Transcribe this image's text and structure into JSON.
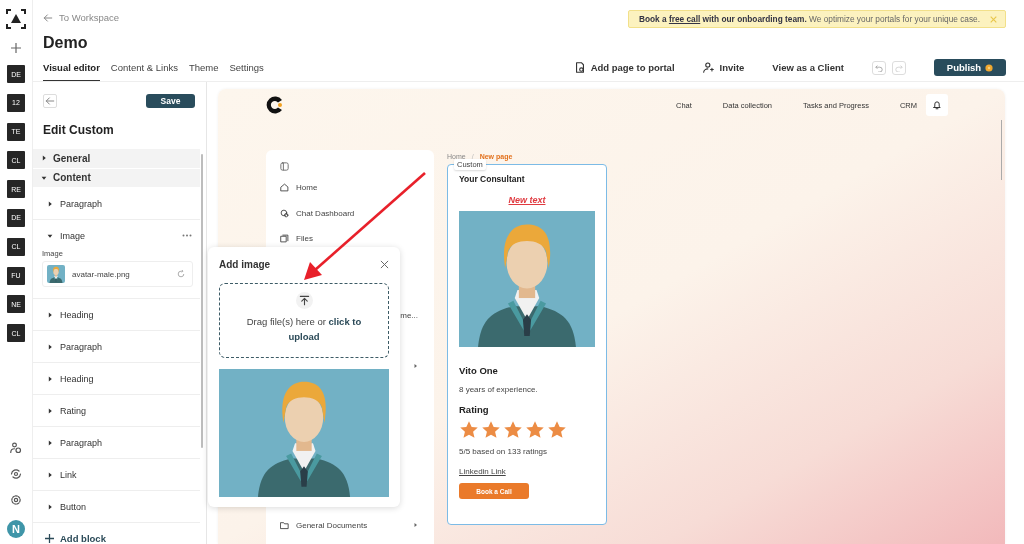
{
  "rail": {
    "tiles": [
      "DE",
      "12",
      "TE",
      "CL",
      "RE",
      "DE",
      "CL",
      "FU",
      "NE",
      "CL"
    ],
    "avatar": "N"
  },
  "header": {
    "back_link": "To Workspace",
    "title": "Demo",
    "tabs": [
      {
        "label": "Visual editor",
        "selected": true
      },
      {
        "label": "Content & Links",
        "selected": false
      },
      {
        "label": "Theme",
        "selected": false
      },
      {
        "label": "Settings",
        "selected": false
      }
    ]
  },
  "banner": {
    "before": "Book a ",
    "link": "free call",
    "after": " with our onboarding team.",
    "message": "We optimize your portals for your unique case."
  },
  "toolbar": {
    "actions": [
      {
        "kind": "add-page",
        "label": "Add page to portal"
      },
      {
        "kind": "invite",
        "label": "Invite"
      },
      {
        "kind": "view",
        "label": "View as a Client"
      }
    ],
    "publish": "Publish"
  },
  "editor_panel": {
    "save": "Save",
    "title": "Edit Custom",
    "sections": [
      {
        "label": "General",
        "expanded": false
      },
      {
        "label": "Content",
        "expanded": true
      }
    ],
    "blocks": [
      {
        "kind": "text",
        "label": "Paragraph",
        "expanded": false
      },
      {
        "kind": "image",
        "label": "Image",
        "expanded": true,
        "field_label": "Image",
        "file_name": "avatar-male.png"
      },
      {
        "kind": "text",
        "label": "Heading",
        "expanded": false
      },
      {
        "kind": "text",
        "label": "Paragraph",
        "expanded": false
      },
      {
        "kind": "text",
        "label": "Heading",
        "expanded": false
      },
      {
        "kind": "text",
        "label": "Rating",
        "expanded": false
      },
      {
        "kind": "text",
        "label": "Paragraph",
        "expanded": false
      },
      {
        "kind": "text",
        "label": "Link",
        "expanded": false
      },
      {
        "kind": "text",
        "label": "Button",
        "expanded": false
      }
    ],
    "add_block": "Add block"
  },
  "portal": {
    "nav": [
      "Chat",
      "Data collection",
      "Tasks and Progress",
      "CRM"
    ],
    "sidebar": [
      {
        "kind": "home",
        "label": "Home"
      },
      {
        "kind": "chat",
        "label": "Chat Dashboard"
      },
      {
        "kind": "files",
        "label": "Files"
      },
      {
        "kind": "clipped",
        "label": "me..."
      },
      {
        "kind": "covered",
        "has_children": true
      },
      {
        "kind": "folder",
        "label": "General Documents",
        "has_children": true
      }
    ],
    "breadcrumb_separator": "/",
    "breadcrumb": [
      {
        "label": "Home",
        "selected": false
      },
      {
        "label": "New page",
        "selected": true
      }
    ],
    "card": {
      "tag": "Custom",
      "heading": "Your Consultant",
      "accent_text": "New text",
      "name": "Vito One",
      "experience": "8 years of experience.",
      "rating_label": "Rating",
      "stars": 5,
      "rating_text": "5/5 based on 133 ratings",
      "link": "Linkedin Link",
      "button": "Book a Call"
    }
  },
  "popup": {
    "title": "Add image",
    "drop_text": "Drag file(s) here or ",
    "drop_link": "click to upload"
  }
}
